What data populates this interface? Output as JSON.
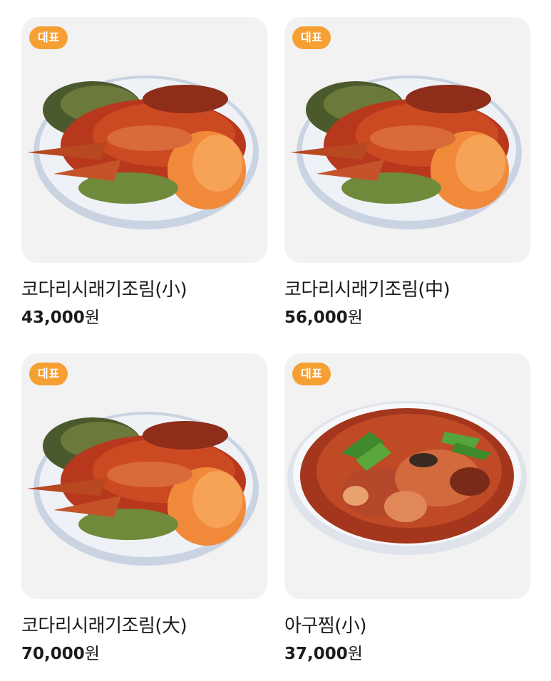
{
  "menu": {
    "items": [
      {
        "badge": "대표",
        "name": "코다리시래기조림(小)",
        "price": "43,000",
        "unit": "원",
        "image": "braised-pollock-radish-greens-plate"
      },
      {
        "badge": "대표",
        "name": "코다리시래기조림(中)",
        "price": "56,000",
        "unit": "원",
        "image": "braised-pollock-radish-greens-plate"
      },
      {
        "badge": "대표",
        "name": "코다리시래기조림(大)",
        "price": "70,000",
        "unit": "원",
        "image": "braised-pollock-radish-greens-plate"
      },
      {
        "badge": "대표",
        "name": "아구찜(小)",
        "price": "37,000",
        "unit": "원",
        "image": "spicy-braised-monkfish-plate"
      }
    ]
  },
  "colors": {
    "badge": "#f6a033",
    "card_bg": "#f2f2f3",
    "text": "#1b1b1b"
  }
}
